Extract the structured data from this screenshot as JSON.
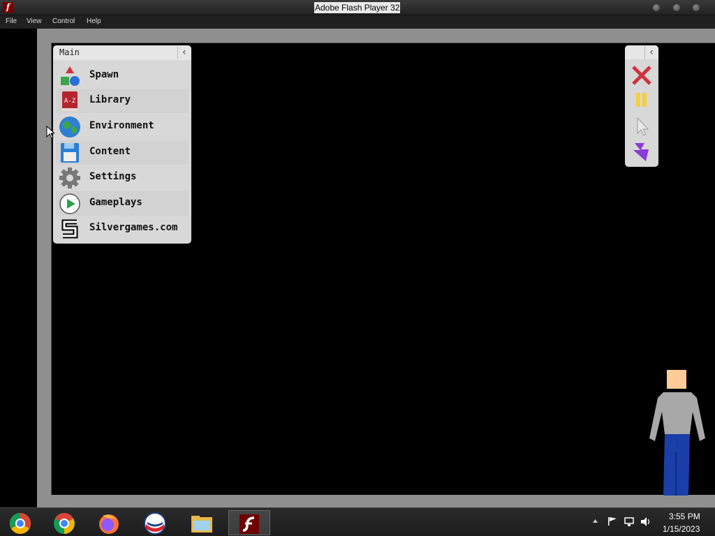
{
  "window": {
    "title": "Adobe Flash Player 32",
    "app_icon_glyph": "f"
  },
  "menubar": {
    "items": [
      "File",
      "View",
      "Control",
      "Help"
    ]
  },
  "main_panel": {
    "title": "Main",
    "collapse_icon": "chevron-left-icon",
    "items": [
      {
        "label": "Spawn",
        "icon": "spawn-shapes-icon"
      },
      {
        "label": "Library",
        "icon": "a-z-book-icon"
      },
      {
        "label": "Environment",
        "icon": "globe-icon"
      },
      {
        "label": "Content",
        "icon": "floppy-disk-icon"
      },
      {
        "label": "Settings",
        "icon": "gear-icon"
      },
      {
        "label": "Gameplays",
        "icon": "play-icon"
      },
      {
        "label": "Silvergames.com",
        "icon": "silvergames-logo-icon"
      }
    ]
  },
  "tool_panel": {
    "collapse_icon": "chevron-left-icon",
    "tools": [
      "close-x-icon",
      "pause-icon",
      "pointer-icon",
      "lightning-icon"
    ]
  },
  "colors": {
    "delete": "#d0323c",
    "pause": "#f5cf3a",
    "lightning": "#8a3bd6",
    "character_head": "#ffcc99",
    "character_shirt": "#a8a8a8",
    "character_pants": "#1a3fa8"
  },
  "taskbar": {
    "apps": [
      "chrome-canary-icon",
      "chrome-icon",
      "firefox-icon",
      "opera-icon",
      "file-explorer-icon",
      "flash-player-icon"
    ],
    "active_app": "flash-player-icon"
  },
  "tray": {
    "icons": [
      "chevron-up-icon",
      "flag-icon",
      "network-icon",
      "volume-icon"
    ],
    "time": "3:55 PM",
    "date": "1/15/2023"
  }
}
